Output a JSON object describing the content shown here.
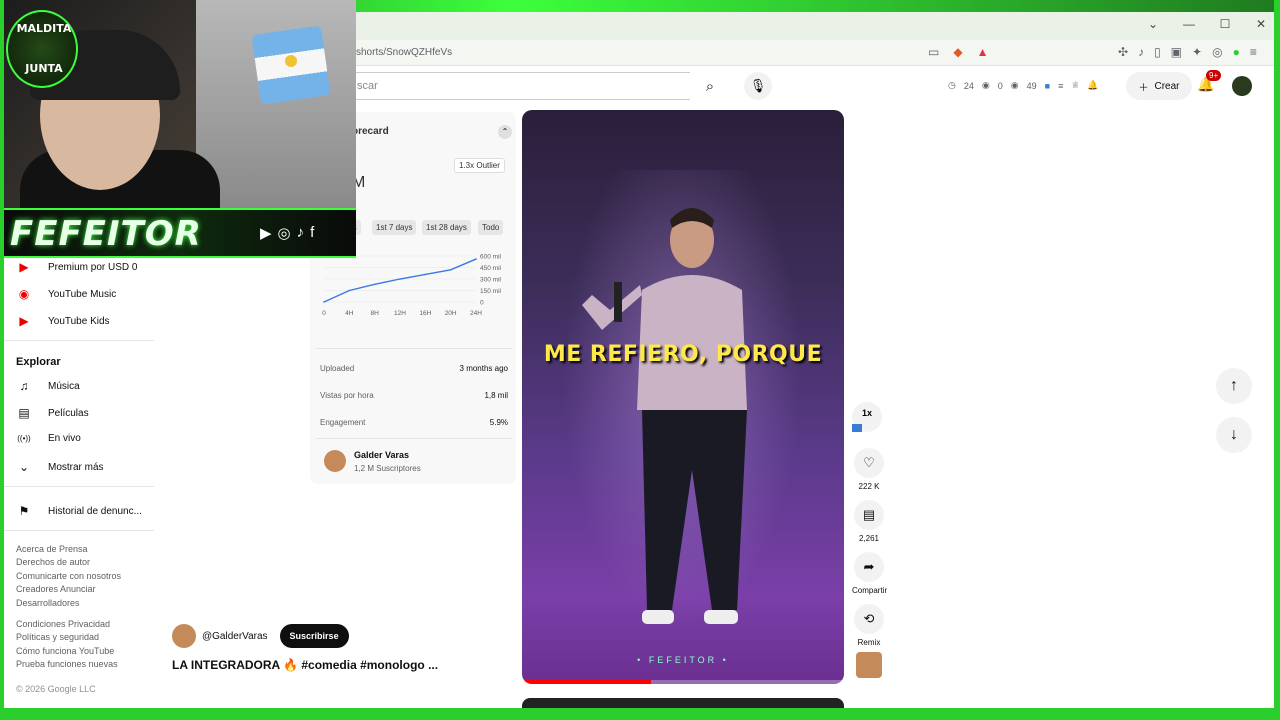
{
  "browser": {
    "url": "shorts/SnowQZHfeVs",
    "window_controls": [
      "⌄",
      "—",
      "☐",
      "✕"
    ]
  },
  "header": {
    "search_placeholder": "scar",
    "stats": {
      "a": "24",
      "b": "0",
      "c": "49"
    },
    "create_label": "Crear",
    "notif_badge": "9+"
  },
  "sidebar": {
    "items_top": [
      {
        "label": "Premium por USD 0"
      },
      {
        "label": "YouTube Music"
      },
      {
        "label": "YouTube Kids"
      }
    ],
    "explore_heading": "Explorar",
    "explore_items": [
      {
        "label": "Música",
        "icon": "♫"
      },
      {
        "label": "Películas",
        "icon": "▤"
      },
      {
        "label": "En vivo",
        "icon": "((•))"
      },
      {
        "label": "Mostrar más",
        "icon": "⌄"
      }
    ],
    "report_history": "Historial de denunc...",
    "footer_lines": [
      "Acerca de  Prensa",
      "Derechos de autor",
      "Comunicarte con nosotros",
      "Creadores  Anunciar",
      "Desarrolladores"
    ],
    "footer_lines2": [
      "Condiciones  Privacidad",
      "Políticas y seguridad",
      "Cómo funciona YouTube",
      "Prueba funciones nuevas"
    ],
    "copyright": "© 2026 Google LLC"
  },
  "scorecard": {
    "title": "orecard",
    "outlier": "1.3x Outlier",
    "big_value": "M",
    "tabs": [
      "rs",
      "1st 7 days",
      "1st 28 days",
      "Todo"
    ],
    "chart_data": {
      "type": "line",
      "x": [
        "0",
        "4H",
        "8H",
        "12H",
        "16H",
        "20H",
        "24H"
      ],
      "values": [
        0,
        150000,
        230000,
        300000,
        360000,
        420000,
        560000
      ],
      "y_ticks": [
        "600 mil",
        "450 mil",
        "300 mil",
        "150 mil",
        "0"
      ],
      "ylim": [
        0,
        600000
      ],
      "color": "#3b78e7"
    },
    "rows": [
      {
        "label": "Uploaded",
        "value": "3 months ago"
      },
      {
        "label": "Vistas por hora",
        "value": "1,8 mil"
      },
      {
        "label": "Engagement",
        "value": "5.9%"
      }
    ],
    "channel_name": "Galder Varas",
    "channel_subs": "1,2 M Suscriptores"
  },
  "video": {
    "caption": "ME REFIERO, PORQUE",
    "watermark": "• FEFEITOR •",
    "progress": 0.4
  },
  "actions": {
    "speed": "1x",
    "likes": "222 K",
    "comments": "2,261",
    "share": "Compartir",
    "remix": "Remix"
  },
  "meta": {
    "channel_handle": "@GalderVaras",
    "subscribe_label": "Suscribirse",
    "title": "LA INTEGRADORA 🔥 #comedia #monologo ..."
  },
  "overlay": {
    "logo_top": "MALDITA",
    "logo_bottom": "JUNTA",
    "banner": "FEFEITOR"
  }
}
